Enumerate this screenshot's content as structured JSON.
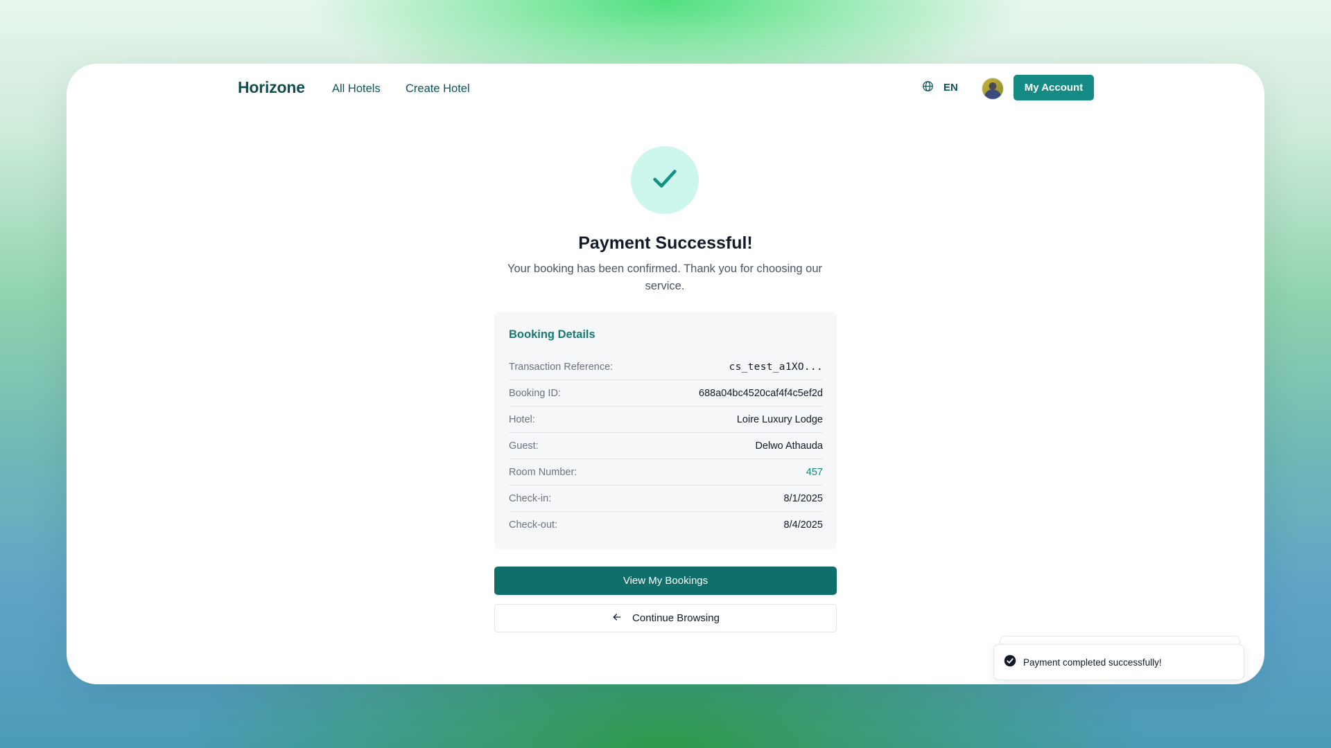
{
  "nav": {
    "brand": "Horizone",
    "links": [
      "All Hotels",
      "Create Hotel"
    ],
    "language": "EN",
    "account_button": "My Account"
  },
  "main": {
    "title": "Payment Successful!",
    "subtitle": "Your booking has been confirmed. Thank you for choosing our service.",
    "details": {
      "heading": "Booking Details",
      "rows": [
        {
          "label": "Transaction Reference:",
          "value": "cs_test_a1XO..."
        },
        {
          "label": "Booking ID:",
          "value": "688a04bc4520caf4f4c5ef2d"
        },
        {
          "label": "Hotel:",
          "value": "Loire Luxury Lodge"
        },
        {
          "label": "Guest:",
          "value": "Delwo Athauda"
        },
        {
          "label": "Room Number:",
          "value": "457"
        },
        {
          "label": "Check-in:",
          "value": "8/1/2025"
        },
        {
          "label": "Check-out:",
          "value": "8/4/2025"
        }
      ]
    },
    "primary_button": "View My Bookings",
    "secondary_button": "Continue Browsing"
  },
  "toast": {
    "message": "Payment completed successfully!"
  },
  "icons": {
    "globe": "globe-icon",
    "check": "check-icon",
    "arrow_left": "arrow-left-icon",
    "toast_check": "check-circle-icon"
  },
  "colors": {
    "brand": "#0f4f52",
    "primary": "#106f6b",
    "accent_button": "#168a84",
    "success_bg": "#cdf6ec",
    "success_check": "#129184"
  }
}
